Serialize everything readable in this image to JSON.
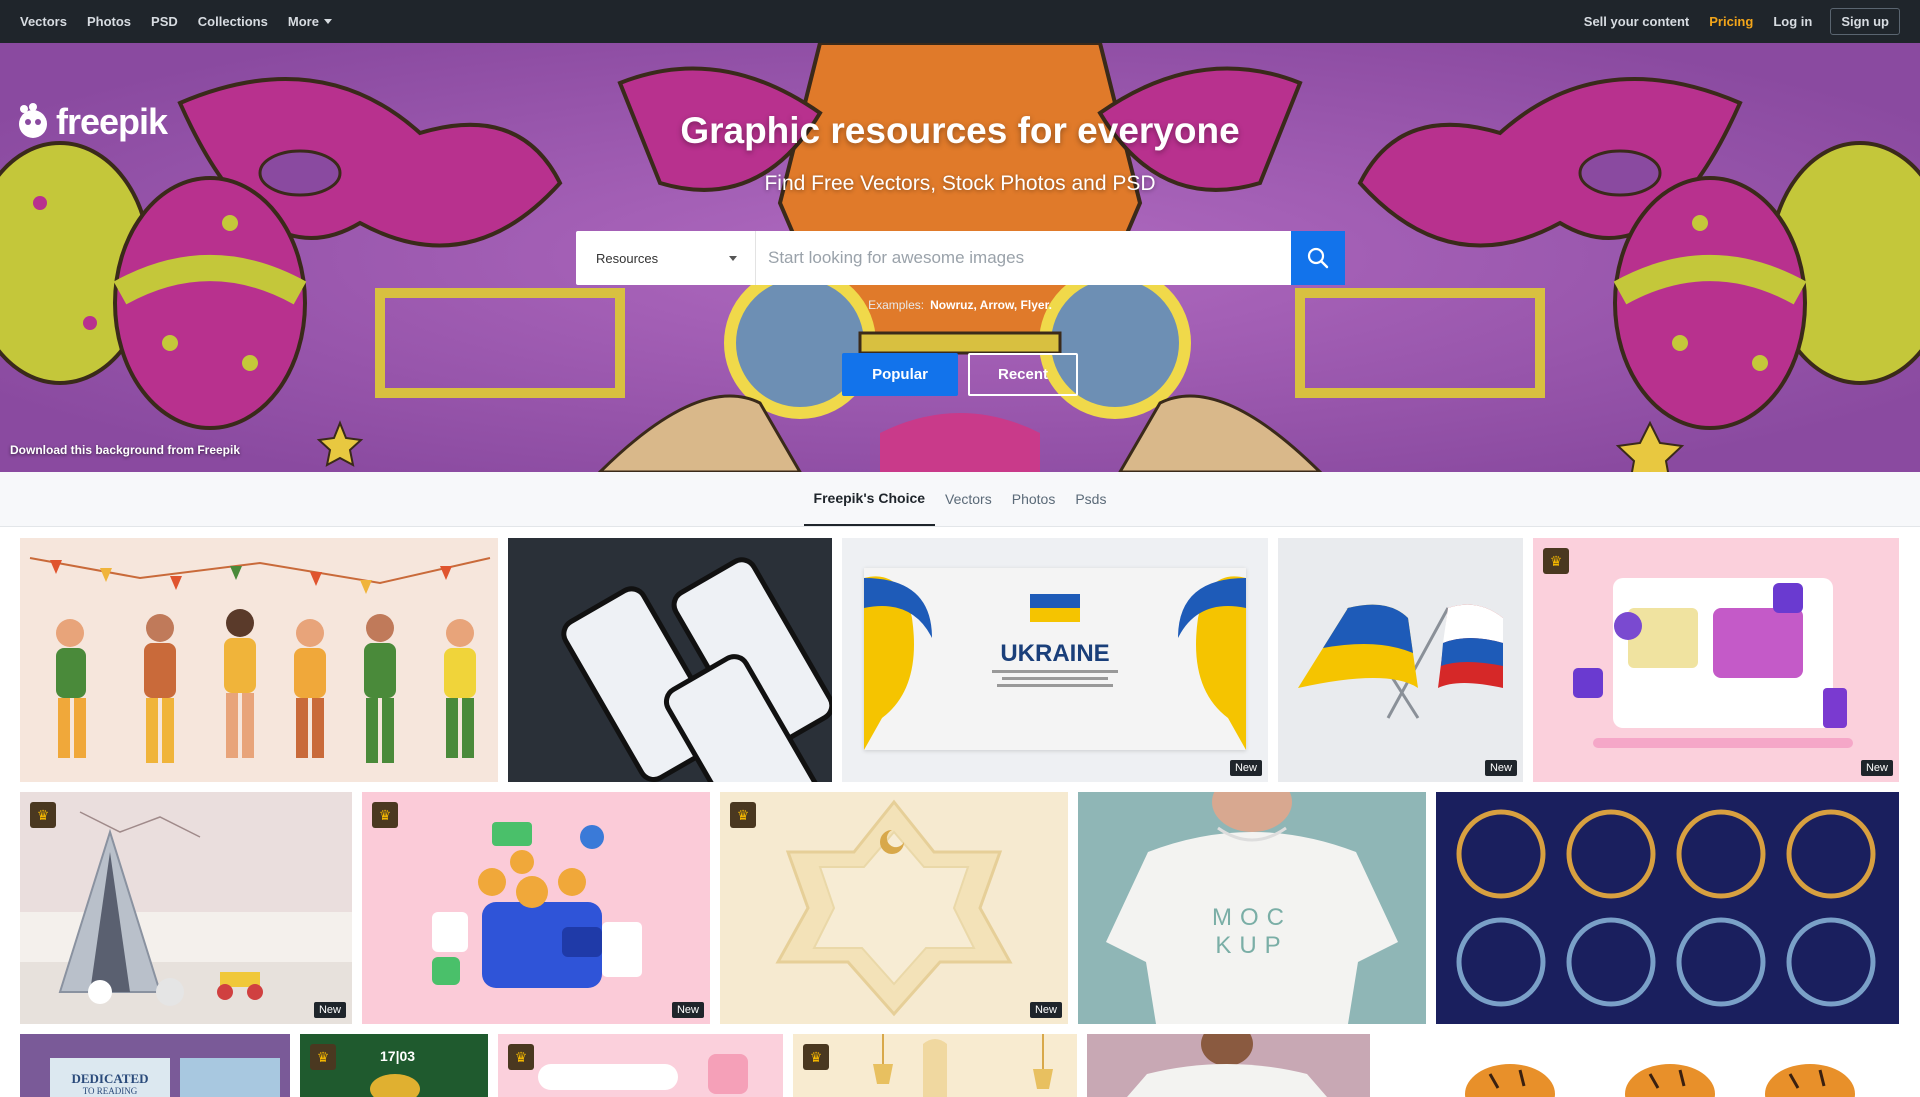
{
  "nav": {
    "left": [
      "Vectors",
      "Photos",
      "PSD",
      "Collections",
      "More"
    ],
    "sell": "Sell your content",
    "pricing": "Pricing",
    "login": "Log in",
    "signup": "Sign up"
  },
  "hero": {
    "logo": "freepik",
    "title": "Graphic resources for everyone",
    "subtitle": "Find Free Vectors, Stock Photos and PSD",
    "search": {
      "category": "Resources",
      "placeholder": "Start looking for awesome images"
    },
    "examples_label": "Examples:",
    "examples": "Nowruz, Arrow, Flyer.",
    "popular": "Popular",
    "recent": "Recent",
    "credit": "Download this background from Freepik"
  },
  "tabs": [
    "Freepik's Choice",
    "Vectors",
    "Photos",
    "Psds"
  ],
  "tiles": {
    "ukraine_title": "UKRAINE",
    "mockup_line1": "MOC",
    "mockup_line2": "KUP",
    "book_title": "DEDICATED",
    "book_sub": "TO READING",
    "date_card": "17|03",
    "new_label": "New"
  },
  "colors": {
    "nav_bg": "#1f252b",
    "accent_blue": "#1273eb",
    "pricing": "#f2a51a"
  }
}
